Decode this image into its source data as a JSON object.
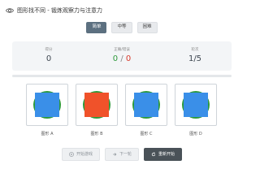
{
  "header": {
    "title": "图形找不同 - 锻炼观察力与注意力",
    "icon": "eye-icon"
  },
  "difficulty": {
    "options": [
      "简单",
      "中等",
      "困难"
    ],
    "selected": "简单"
  },
  "stats": {
    "score_label": "得分",
    "score_value": "0",
    "correct_wrong_label": "正确/错误",
    "correct_value": "0",
    "separator": "/",
    "wrong_value": "0",
    "round_label": "轮次",
    "round_value": "1/5"
  },
  "progress": {
    "fraction": 0.0
  },
  "cards": [
    {
      "label": "图形 A",
      "fill": "#3a8fe8"
    },
    {
      "label": "图形 B",
      "fill": "#f0522a"
    },
    {
      "label": "图形 C",
      "fill": "#3a8fe8"
    },
    {
      "label": "图形 D",
      "fill": "#3a8fe8"
    }
  ],
  "controls": {
    "start_label": "开始游戏",
    "next_label": "下一轮",
    "restart_label": "重新开始"
  },
  "colors": {
    "accent": "#5c7080",
    "shape_blue": "#3a8fe8",
    "shape_orange": "#f0522a",
    "circle_green": "#2e9a3c"
  }
}
